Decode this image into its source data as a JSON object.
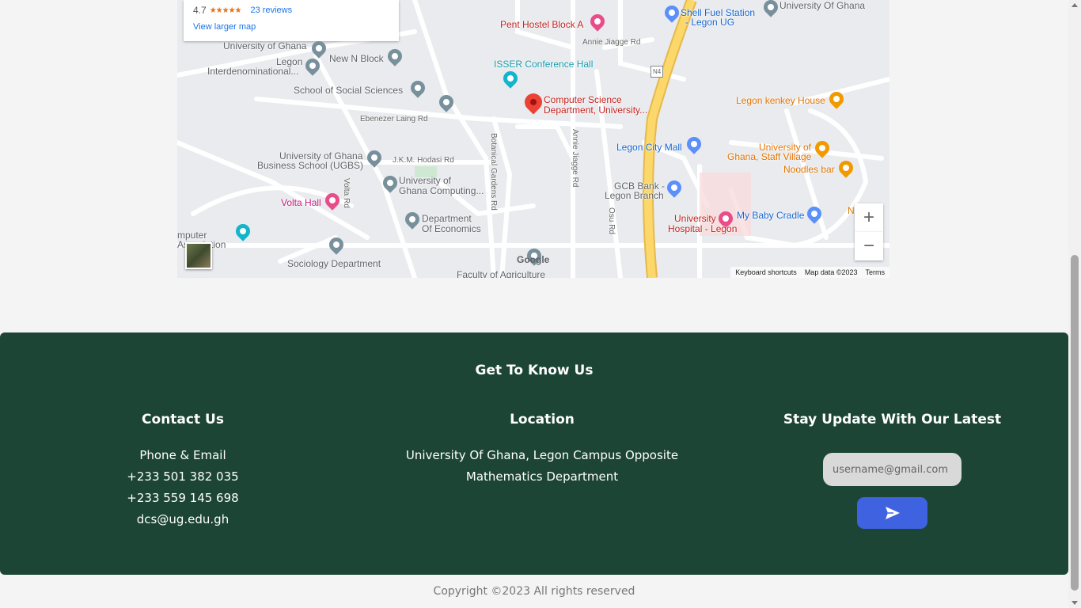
{
  "map": {
    "rating": "4.7",
    "stars": "★★★★★",
    "reviews": "23 reviews",
    "larger_map": "View larger map",
    "labels": {
      "ug_top": "University Of Ghana",
      "ug_left": "University of Ghana",
      "legon_inter_1": "Legon",
      "legon_inter_2": "Interdenominational...",
      "new_n_block": "New N Block",
      "social_sciences": "School of Social Sciences",
      "ebenezer": "Ebenezer Laing Rd",
      "ugbs_1": "University of Ghana",
      "ugbs_2": "Business School (UGBS)",
      "hodasi": "J.K.M. Hodasi Rd",
      "ug_computing_1": "University of",
      "ug_computing_2": "Ghana Computing...",
      "volta_hall": "Volta Hall",
      "volta_rd": "Volta Rd",
      "computer_asso_1": "mputer",
      "computer_asso_2": "Association",
      "economics_1": "Department",
      "economics_2": "Of Economics",
      "sociology": "Sociology Department",
      "faculty_agric": "Faculty of Agriculture",
      "botanical": "Botanical Gardens Rd",
      "annie_vertical": "Annie Jiagge Rd",
      "annie_top": "Annie Jiagge Rd",
      "pent_hostel": "Pent Hostel Block A",
      "isser": "ISSER Conference Hall",
      "csd_1": "Computer Science",
      "csd_2": "Department, University...",
      "shell_1": "Shell Fuel Station",
      "shell_2": "- Legon UG",
      "n4": "N4",
      "legon_city_mall": "Legon City Mall",
      "gcb_1": "GCB Bank -",
      "gcb_2": "Legon Branch",
      "osu_rd": "Osu Rd",
      "hospital_1": "University",
      "hospital_2": "Hospital - Legon",
      "baby_cradle": "My Baby Cradle",
      "kenkey": "Legon kenkey House",
      "staff_village_1": "University of",
      "staff_village_2": "Ghana, Staff Village",
      "noodles": "Noodles bar",
      "n_partial": "N"
    },
    "zoom_in": "+",
    "zoom_out": "−",
    "google": "Google",
    "keyboard": "Keyboard shortcuts",
    "map_data": "Map data ©2023",
    "terms": "Terms"
  },
  "footer": {
    "heading": "Get To Know Us",
    "contact": {
      "title": "Contact Us",
      "lines": [
        "Phone & Email",
        "+233 501 382 035",
        "+233 559 145 698",
        "dcs@ug.edu.gh"
      ]
    },
    "location": {
      "title": "Location",
      "lines": [
        "University Of Ghana, Legon Campus Opposite",
        "Mathematics Department"
      ]
    },
    "stay": {
      "title": "Stay Update With Our Latest",
      "email_placeholder": "username@gmail.com",
      "send_icon": "send-icon"
    }
  },
  "copyright": "Copyright ©2023 All rights reserved",
  "colors": {
    "footer_bg": "#1c4536",
    "send_button": "#3f63e0",
    "page_bg": "#f4f4f4"
  }
}
